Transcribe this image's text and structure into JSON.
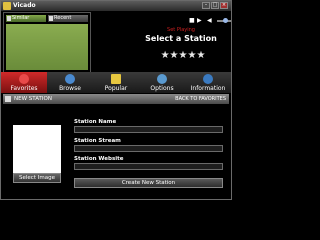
{
  "window": {
    "title": "Vicado"
  },
  "left_panel": {
    "tabs": [
      {
        "label": "Similar"
      },
      {
        "label": "Recent"
      }
    ]
  },
  "now_playing": {
    "set_playing": "Set Playing",
    "station_title": "Select a Station",
    "rating": "★★★★★"
  },
  "nav": {
    "tabs": [
      {
        "label": "Favorites",
        "icon": "heart-icon",
        "active": true
      },
      {
        "label": "Browse",
        "icon": "globe-icon"
      },
      {
        "label": "Popular",
        "icon": "star-icon"
      },
      {
        "label": "Options",
        "icon": "gear-icon"
      },
      {
        "label": "Information",
        "icon": "info-icon"
      }
    ]
  },
  "section": {
    "title": "NEW STATION",
    "back_label": "BACK TO FAVORITES"
  },
  "form": {
    "station_name_label": "Station Name",
    "station_name_value": "",
    "station_stream_label": "Station Stream",
    "station_stream_value": "",
    "station_website_label": "Station Website",
    "station_website_value": "",
    "select_image_label": "Select Image",
    "create_label": "Create New Station"
  },
  "colors": {
    "accent": "#c42424",
    "panel_green": "#7a9c44"
  }
}
